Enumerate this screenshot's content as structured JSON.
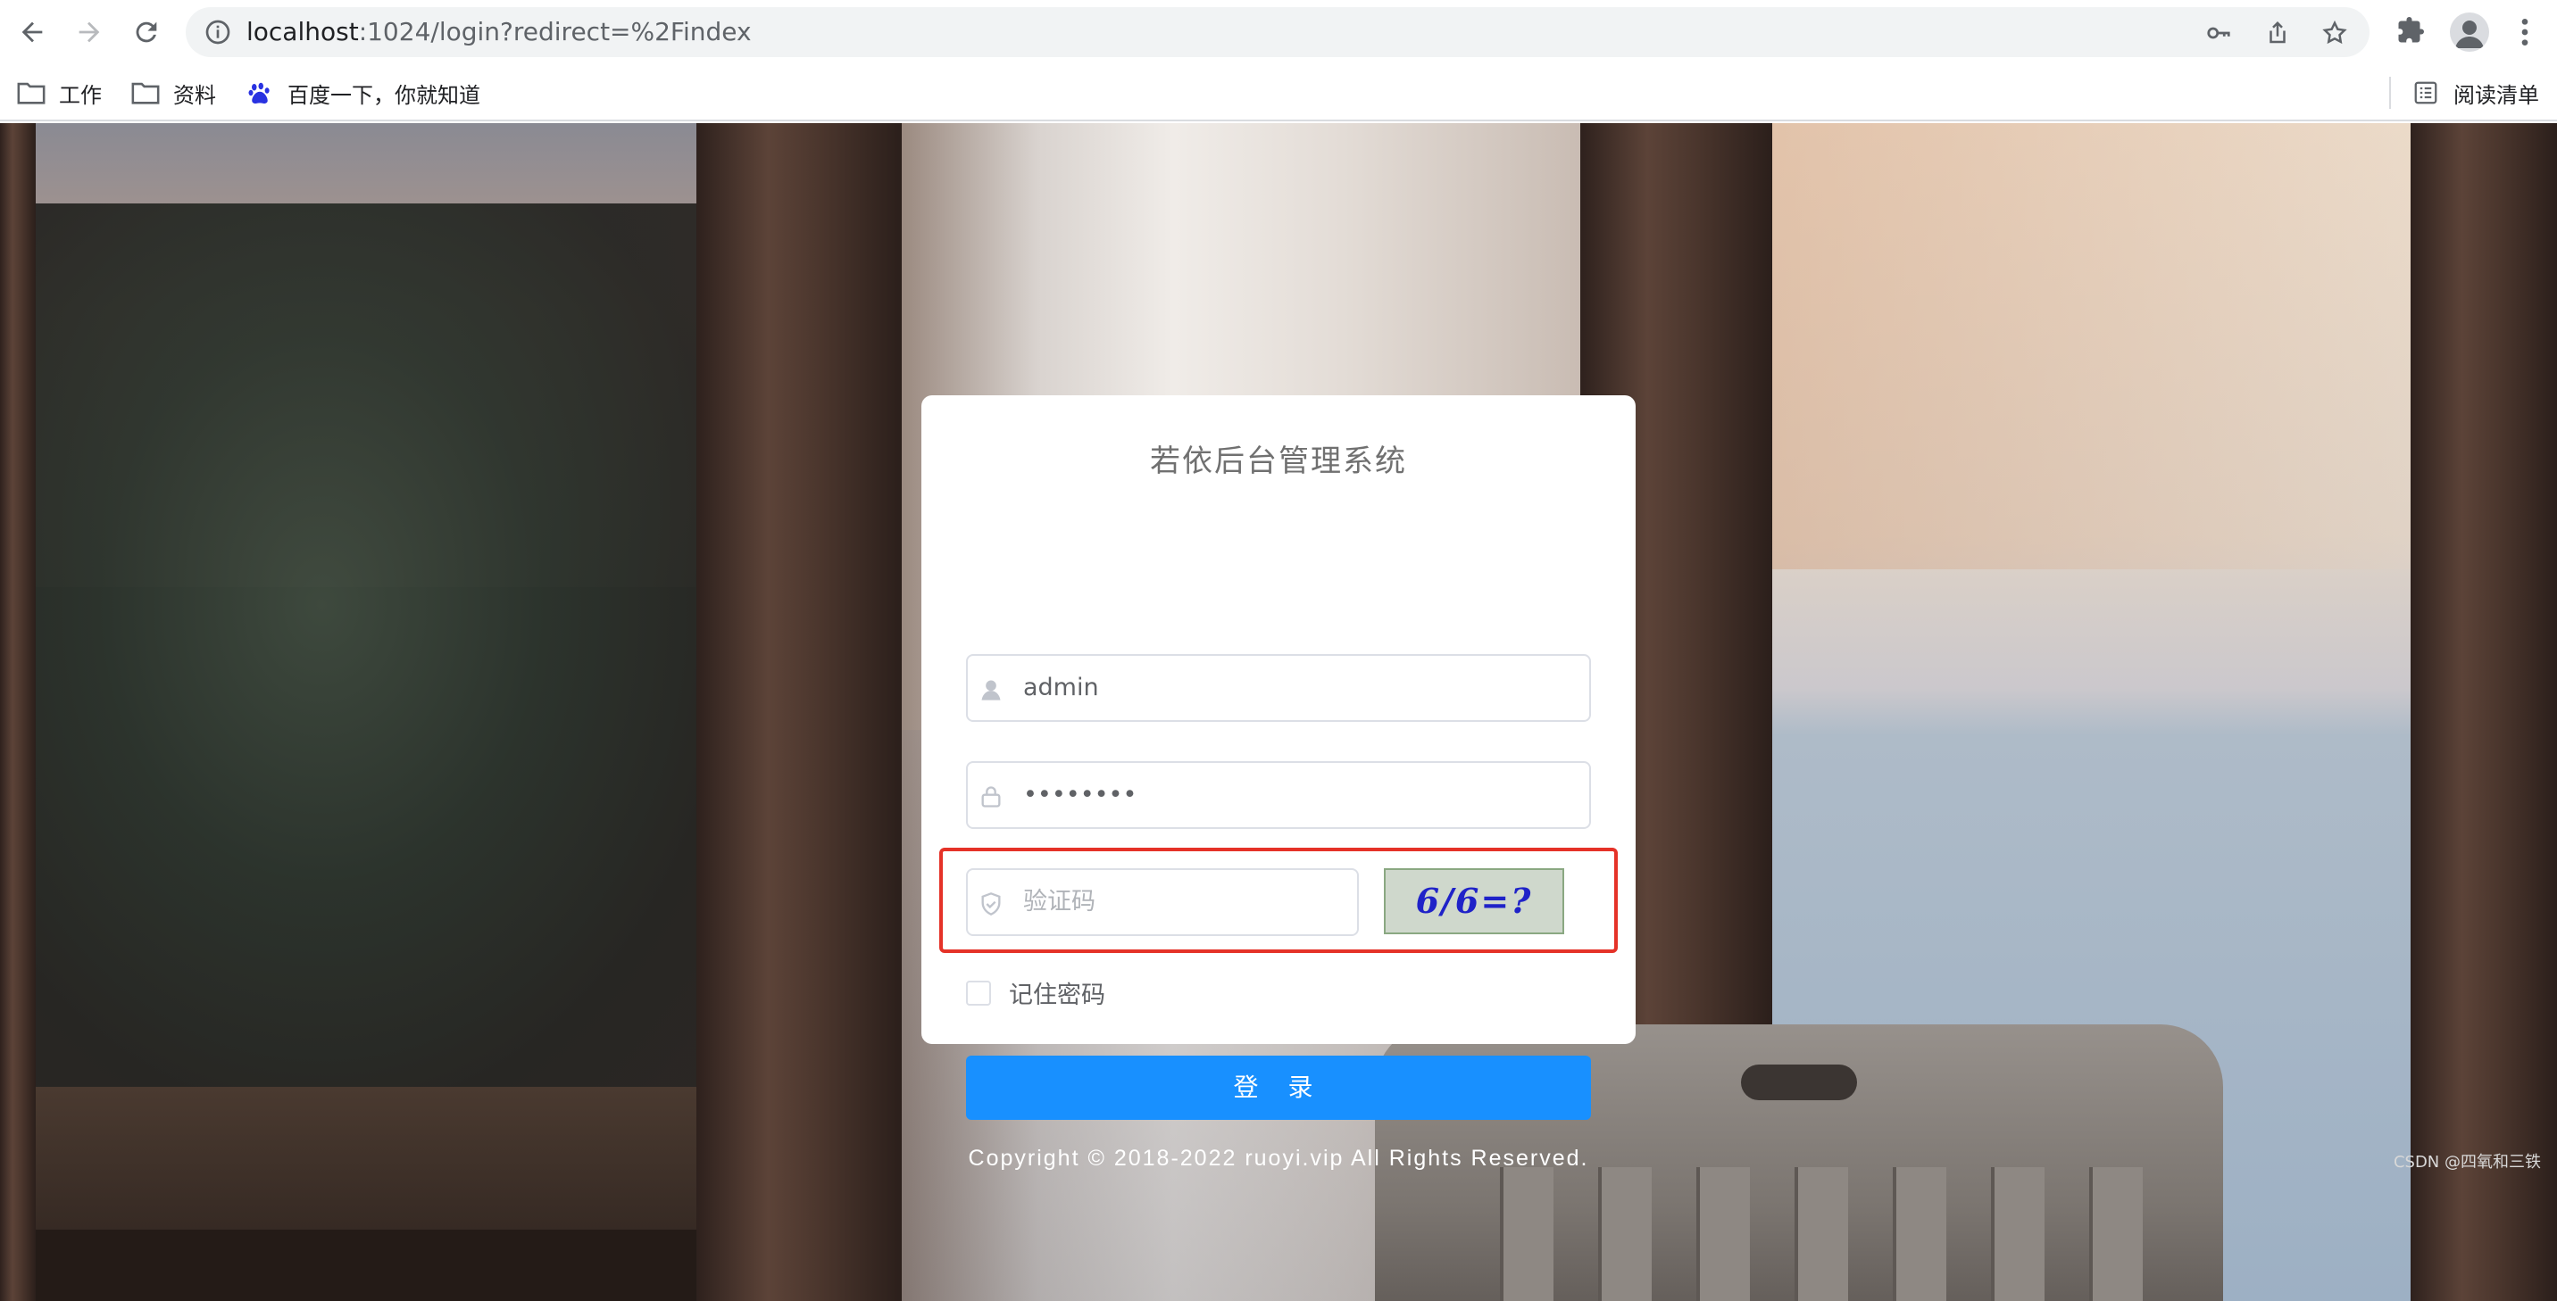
{
  "browser": {
    "url_host": "localhost",
    "url_path": ":1024/login?redirect=%2Findex",
    "icons": {
      "back": "arrow-left-icon",
      "forward": "arrow-right-icon",
      "reload": "reload-icon",
      "site_info": "info-icon",
      "password_key": "key-icon",
      "share": "share-icon",
      "bookmark_star": "star-icon",
      "extensions": "puzzle-icon",
      "profile": "avatar-icon",
      "menu": "kebab-icon"
    }
  },
  "bookmarks": {
    "items": [
      {
        "label": "工作",
        "icon": "folder-icon"
      },
      {
        "label": "资料",
        "icon": "folder-icon"
      },
      {
        "label": "百度一下，你就知道",
        "icon": "baidu-paw-icon"
      }
    ],
    "reading_list": "阅读清单"
  },
  "login": {
    "title": "若依后台管理系统",
    "username_value": "admin",
    "password_value": "••••••••",
    "code_placeholder": "验证码",
    "captcha_text": "6/6=?",
    "remember_label": "记住密码",
    "remember_checked": false,
    "login_button": "登 录"
  },
  "footer": {
    "copyright": "Copyright © 2018-2022 ruoyi.vip All Rights Reserved.",
    "watermark": "CSDN @四氧和三铁"
  },
  "colors": {
    "primary": "#1890ff",
    "highlight": "#e53228",
    "captcha_text": "#1f22c8"
  }
}
